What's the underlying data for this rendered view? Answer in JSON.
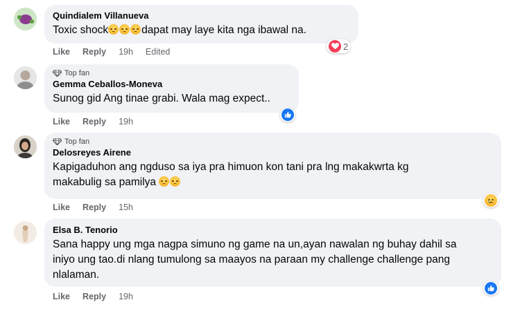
{
  "labels": {
    "like": "Like",
    "reply": "Reply",
    "top_fan": "Top fan"
  },
  "comments": [
    {
      "author": "Quindialem Villanueva",
      "text_before_emoji": "Toxic shock",
      "text_after_emoji": "dapat may laye kita nga ibawal na.",
      "time": "19h",
      "edited": "Edited",
      "reaction": {
        "type": "heart",
        "count": "2"
      }
    },
    {
      "author": "Gemma Ceballos-Moneva",
      "text": "Sunog gid Ang tinae grabi. Wala mag expect..",
      "time": "19h",
      "reaction": {
        "type": "like"
      }
    },
    {
      "author": "Delosreyes Airene",
      "text_line1": "Kapigaduhon ang ngduso sa iya pra himuon kon tani pra lng makakwrta kg",
      "text_line2": "makabulig sa pamilya",
      "time": "15h",
      "reaction": {
        "type": "sad"
      }
    },
    {
      "author": "Elsa B. Tenorio",
      "text_line1": "Sana happy ung mga nagpa simuno ng game na un,ayan nawalan ng buhay dahil sa",
      "text_line2": "iniyo ung tao.di nlang tumulong sa maayos na paraan my challenge challenge pang",
      "text_line3": "nlalaman.",
      "time": "19h",
      "reaction": {
        "type": "like"
      }
    }
  ],
  "colors": {
    "bubble": "#f0f2f5",
    "meta": "#65676b",
    "like_blue": "#1877f2",
    "heart_red": "#f33e58",
    "sad_yellow": "#f7b125"
  }
}
